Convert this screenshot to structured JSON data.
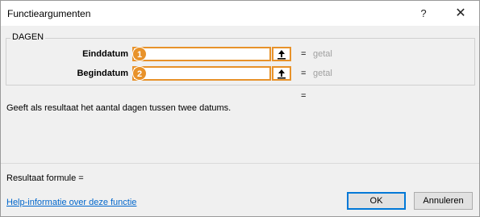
{
  "window": {
    "title": "Functieargumenten",
    "help_glyph": "?",
    "close_glyph": "✕"
  },
  "function": {
    "name": "DAGEN",
    "args": [
      {
        "label": "Einddatum",
        "badge": "1",
        "value": "",
        "result_hint": "getal"
      },
      {
        "label": "Begindatum",
        "badge": "2",
        "value": "",
        "result_hint": "getal"
      }
    ],
    "equals_sign": "=",
    "description": "Geeft als resultaat het aantal dagen tussen twee datums."
  },
  "footer": {
    "result_label": "Resultaat formule =",
    "help_link": "Help-informatie over deze functie",
    "ok_label": "OK",
    "cancel_label": "Annuleren"
  },
  "colors": {
    "accent_orange": "#e8922a",
    "link_blue": "#0066cc",
    "focus_blue": "#0078d7"
  },
  "icons": {
    "ref_button": "collapse-dialog-arrow-up-icon"
  }
}
